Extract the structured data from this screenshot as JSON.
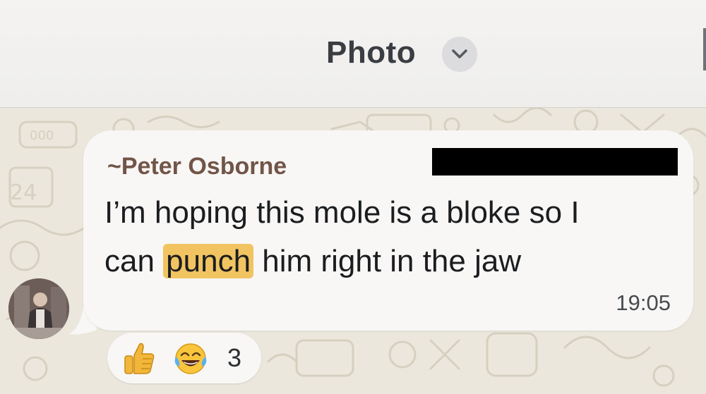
{
  "header": {
    "title": "Photo",
    "menu_icon": "chevron-down-icon"
  },
  "message": {
    "sender": "~Peter Osborne",
    "line1": "I’m hoping this mole is a bloke so I",
    "line2_before": "can ",
    "highlighted_word": "punch",
    "line2_after": " him right in the jaw",
    "time": "19:05",
    "highlight_color": "#f1c461",
    "sender_color": "#725548"
  },
  "reactions": {
    "emoji": [
      "thumbs-up-icon",
      "face-with-tears-of-joy-icon"
    ],
    "count": "3"
  }
}
